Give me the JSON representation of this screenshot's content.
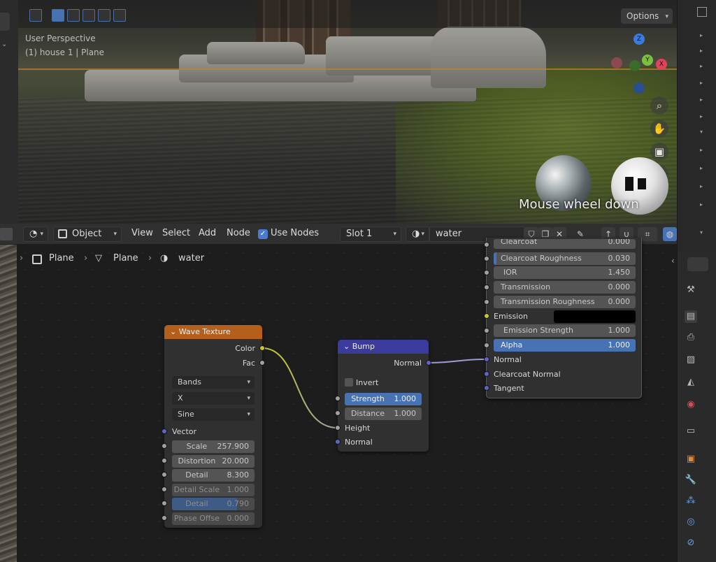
{
  "viewport": {
    "perspective_label": "User Perspective",
    "object_label": "(1) house 1 | Plane",
    "options_label": "Options",
    "gizmo": {
      "z": "Z",
      "y": "Y",
      "x": "X"
    },
    "overlay_text": "Mouse wheel down"
  },
  "node_header": {
    "mode_label": "Object",
    "menu": [
      "View",
      "Select",
      "Add",
      "Node"
    ],
    "use_nodes_label": "Use Nodes",
    "use_nodes_checked": true,
    "slot_label": "Slot 1",
    "material_name": "water"
  },
  "breadcrumb": {
    "object": "Plane",
    "mesh": "Plane",
    "material": "water"
  },
  "wave_texture": {
    "title": "Wave Texture",
    "header_color": "#b55f1c",
    "outputs": [
      "Color",
      "Fac"
    ],
    "type_select": "Bands",
    "direction_select": "X",
    "profile_select": "Sine",
    "vector_label": "Vector",
    "fields": [
      {
        "label": "Scale",
        "value": "257.900"
      },
      {
        "label": "Distortion",
        "value": "20.000"
      },
      {
        "label": "Detail",
        "value": "8.300"
      },
      {
        "label": "Detail Scale",
        "value": "1.000"
      },
      {
        "label": "Detail Roughn",
        "value": "0.790"
      },
      {
        "label": "Phase Offse",
        "value": "0.000"
      }
    ]
  },
  "bump": {
    "title": "Bump",
    "header_color": "#3b3b9b",
    "output": "Normal",
    "invert_label": "Invert",
    "strength": {
      "label": "Strength",
      "value": "1.000"
    },
    "distance": {
      "label": "Distance",
      "value": "1.000"
    },
    "inputs": [
      "Height",
      "Normal"
    ]
  },
  "bsdf": {
    "fields": [
      {
        "label": "Clearcoat",
        "value": "0.000"
      },
      {
        "label": "Clearcoat Roughness",
        "value": "0.030"
      },
      {
        "label": "IOR",
        "value": "1.450"
      },
      {
        "label": "Transmission",
        "value": "0.000"
      },
      {
        "label": "Transmission Roughness",
        "value": "0.000"
      }
    ],
    "emission_label": "Emission",
    "emission_strength": {
      "label": "Emission Strength",
      "value": "1.000"
    },
    "alpha": {
      "label": "Alpha",
      "value": "1.000"
    },
    "inputs": [
      "Normal",
      "Clearcoat Normal",
      "Tangent"
    ]
  }
}
